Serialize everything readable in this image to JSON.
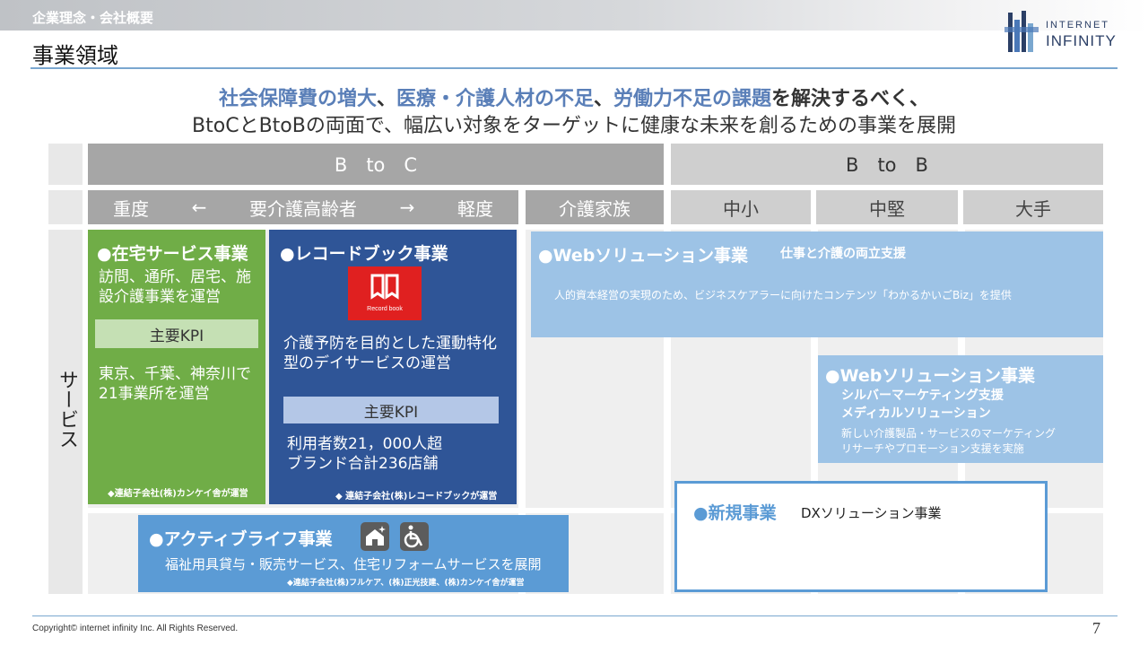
{
  "header": {
    "section_label": "企業理念・会社概要",
    "page_title": "事業領域",
    "logo_top": "INTERNET",
    "logo_bottom": "INFINITY"
  },
  "headline": {
    "line1": [
      {
        "text": "社会保障費の増大",
        "emph": true
      },
      {
        "text": "、",
        "emph": false
      },
      {
        "text": "医療・介護人材の不足",
        "emph": true
      },
      {
        "text": "、",
        "emph": false
      },
      {
        "text": "労働力不足の課題",
        "emph": true
      },
      {
        "text": "を解決するべく、",
        "emph": false
      }
    ],
    "line2": "BtoCとBtoBの両面で、幅広い対象をターゲットに健康な未来を創るための事業を展開"
  },
  "grid": {
    "btoc": "B　to　C",
    "btob": "B　to　B",
    "severity_heavy": "重度",
    "arrow_left": "←",
    "elderly": "要介護高齢者",
    "arrow_right": "→",
    "severity_light": "軽度",
    "family": "介護家族",
    "small": "中小",
    "medium": "中堅",
    "large": "大手",
    "service_label": "サービス"
  },
  "home_service": {
    "title": "●在宅サービス事業",
    "desc": "訪問、通所、居宅、施設介護事業を運営",
    "kpi_label": "主要KPI",
    "kpi": "東京、千葉、神奈川で21事業所を運営",
    "note": "◆連結子会社(株)カンケイ舎が運営"
  },
  "record_book": {
    "title": "●レコードブック事業",
    "logo_text": "Record book",
    "desc": "介護予防を目的とした運動特化型のデイサービスの運営",
    "kpi_label": "主要KPI",
    "kpi_line1": "利用者数21，000人超",
    "kpi_line2": "ブランド合計236店舗",
    "note": "◆ 連結子会社(株)レコードブックが運営"
  },
  "active_life": {
    "title": "●アクティブライフ事業",
    "icons": [
      "house-sparkle-icon",
      "wheelchair-icon"
    ],
    "desc": "福祉用具貸与・販売サービス、住宅リフォームサービスを展開",
    "note": "◆連結子会社(株)フルケア、(株)正光技建、(株)カンケイ舎が運営"
  },
  "web_solution_1": {
    "title": "●Webソリューション事業",
    "subtitle": "仕事と介護の両立支援",
    "desc": "人的資本経営の実現のため、ビジネスケアラーに向けたコンテンツ「わかるかいごBiz」を提供"
  },
  "web_solution_2": {
    "title": "●Webソリューション事業",
    "line1": "シルバーマーケティング支援",
    "line2": "メディカルソリューション",
    "desc1": "新しい介護製品・サービスのマーケティング",
    "desc2": "リサーチやプロモーション支援を実施"
  },
  "new_business": {
    "title": "●新規事業",
    "desc": "DXソリューション事業"
  },
  "footer": {
    "copyright": "Copyright© internet infinity Inc. All Rights Reserved.",
    "page_number": "7"
  },
  "colors": {
    "green": "#70ad47",
    "navy": "#2f5597",
    "mid_blue": "#5b9bd5",
    "pale_blue": "#9dc3e6",
    "record_red": "#e02020",
    "headline_emphasis": "#5a7fb8"
  }
}
